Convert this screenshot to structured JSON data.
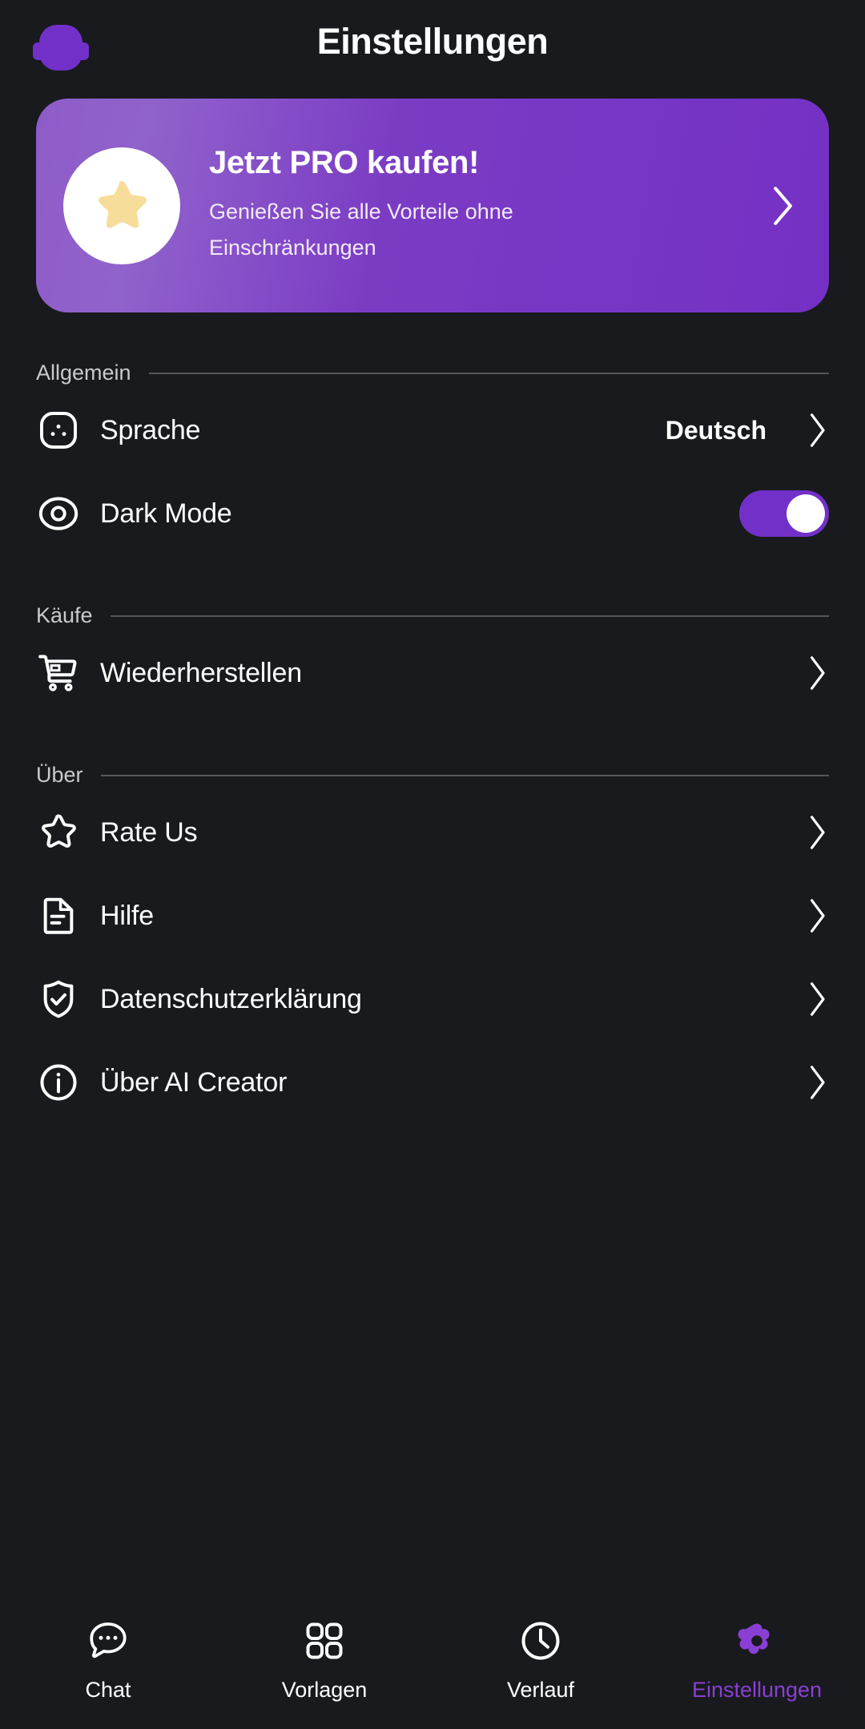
{
  "header": {
    "title": "Einstellungen",
    "logo_icon": "app-logo-blob-icon"
  },
  "promo_banner": {
    "title": "Jetzt PRO kaufen!",
    "subtitle": "Genießen Sie alle Vorteile ohne Einschränkungen",
    "star_icon": "star-filled-icon",
    "chevron_icon": "chevron-right-icon",
    "gradient_from": "#8e5cc8",
    "gradient_to": "#7430c4"
  },
  "sections": [
    {
      "title": "Allgemein",
      "rows": [
        {
          "icon": "language-globe-icon",
          "label": "Sprache",
          "value": "Deutsch",
          "control": "chevron"
        },
        {
          "icon": "eye-circle-icon",
          "label": "Dark Mode",
          "value": "",
          "control": "toggle",
          "toggle_on": true
        }
      ]
    },
    {
      "title": "Käufe",
      "rows": [
        {
          "icon": "shopping-cart-icon",
          "label": "Wiederherstellen",
          "value": "",
          "control": "chevron"
        }
      ]
    },
    {
      "title": "Über",
      "rows": [
        {
          "icon": "star-outline-icon",
          "label": "Rate Us",
          "value": "",
          "control": "chevron"
        },
        {
          "icon": "document-icon",
          "label": "Hilfe",
          "value": "",
          "control": "chevron"
        },
        {
          "icon": "shield-check-icon",
          "label": "Datenschutzerklärung",
          "value": "",
          "control": "chevron"
        },
        {
          "icon": "info-circle-icon",
          "label": "Über AI Creator",
          "value": "",
          "control": "chevron"
        }
      ]
    }
  ],
  "bottom_nav": {
    "active_index": 3,
    "active_color": "#8a3fd4",
    "items": [
      {
        "label": "Chat",
        "icon": "chat-bubble-icon"
      },
      {
        "label": "Vorlagen",
        "icon": "grid-four-icon"
      },
      {
        "label": "Verlauf",
        "icon": "clock-icon"
      },
      {
        "label": "Einstellungen",
        "icon": "gear-icon"
      }
    ]
  }
}
